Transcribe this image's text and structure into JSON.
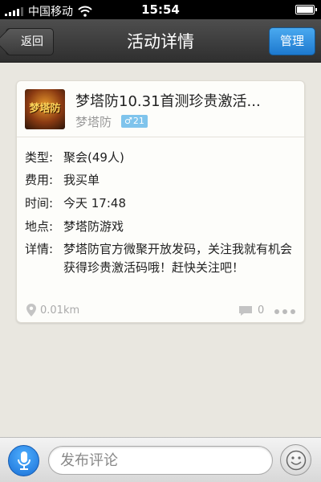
{
  "status_bar": {
    "carrier": "中国移动",
    "time": "15:54"
  },
  "nav": {
    "back_label": "返回",
    "title": "活动详情",
    "manage_label": "管理"
  },
  "event": {
    "title": "梦塔防10.31首测珍贵激活...",
    "avatar_text": "梦塔防",
    "organizer": "梦塔防",
    "gender_symbol": "♂",
    "age": "21",
    "details": [
      {
        "label": "类型:",
        "value": "聚会(49人)"
      },
      {
        "label": "费用:",
        "value": "我买单"
      },
      {
        "label": "时间:",
        "value": "今天 17:48"
      },
      {
        "label": "地点:",
        "value": "梦塔防游戏"
      }
    ],
    "description_label": "详情:",
    "description": "梦塔防官方微聚开放发码，关注我就有机会获得珍贵激活码哦！赶快关注吧！",
    "distance": "0.01km",
    "comment_count": "0"
  },
  "comment_bar": {
    "placeholder": "发布评论"
  },
  "colors": {
    "nav_bg": "#3a3a3a",
    "manage_button": "#2a8ee0",
    "page_bg": "#e9e7e0",
    "gender_badge": "#7fc4ec"
  }
}
